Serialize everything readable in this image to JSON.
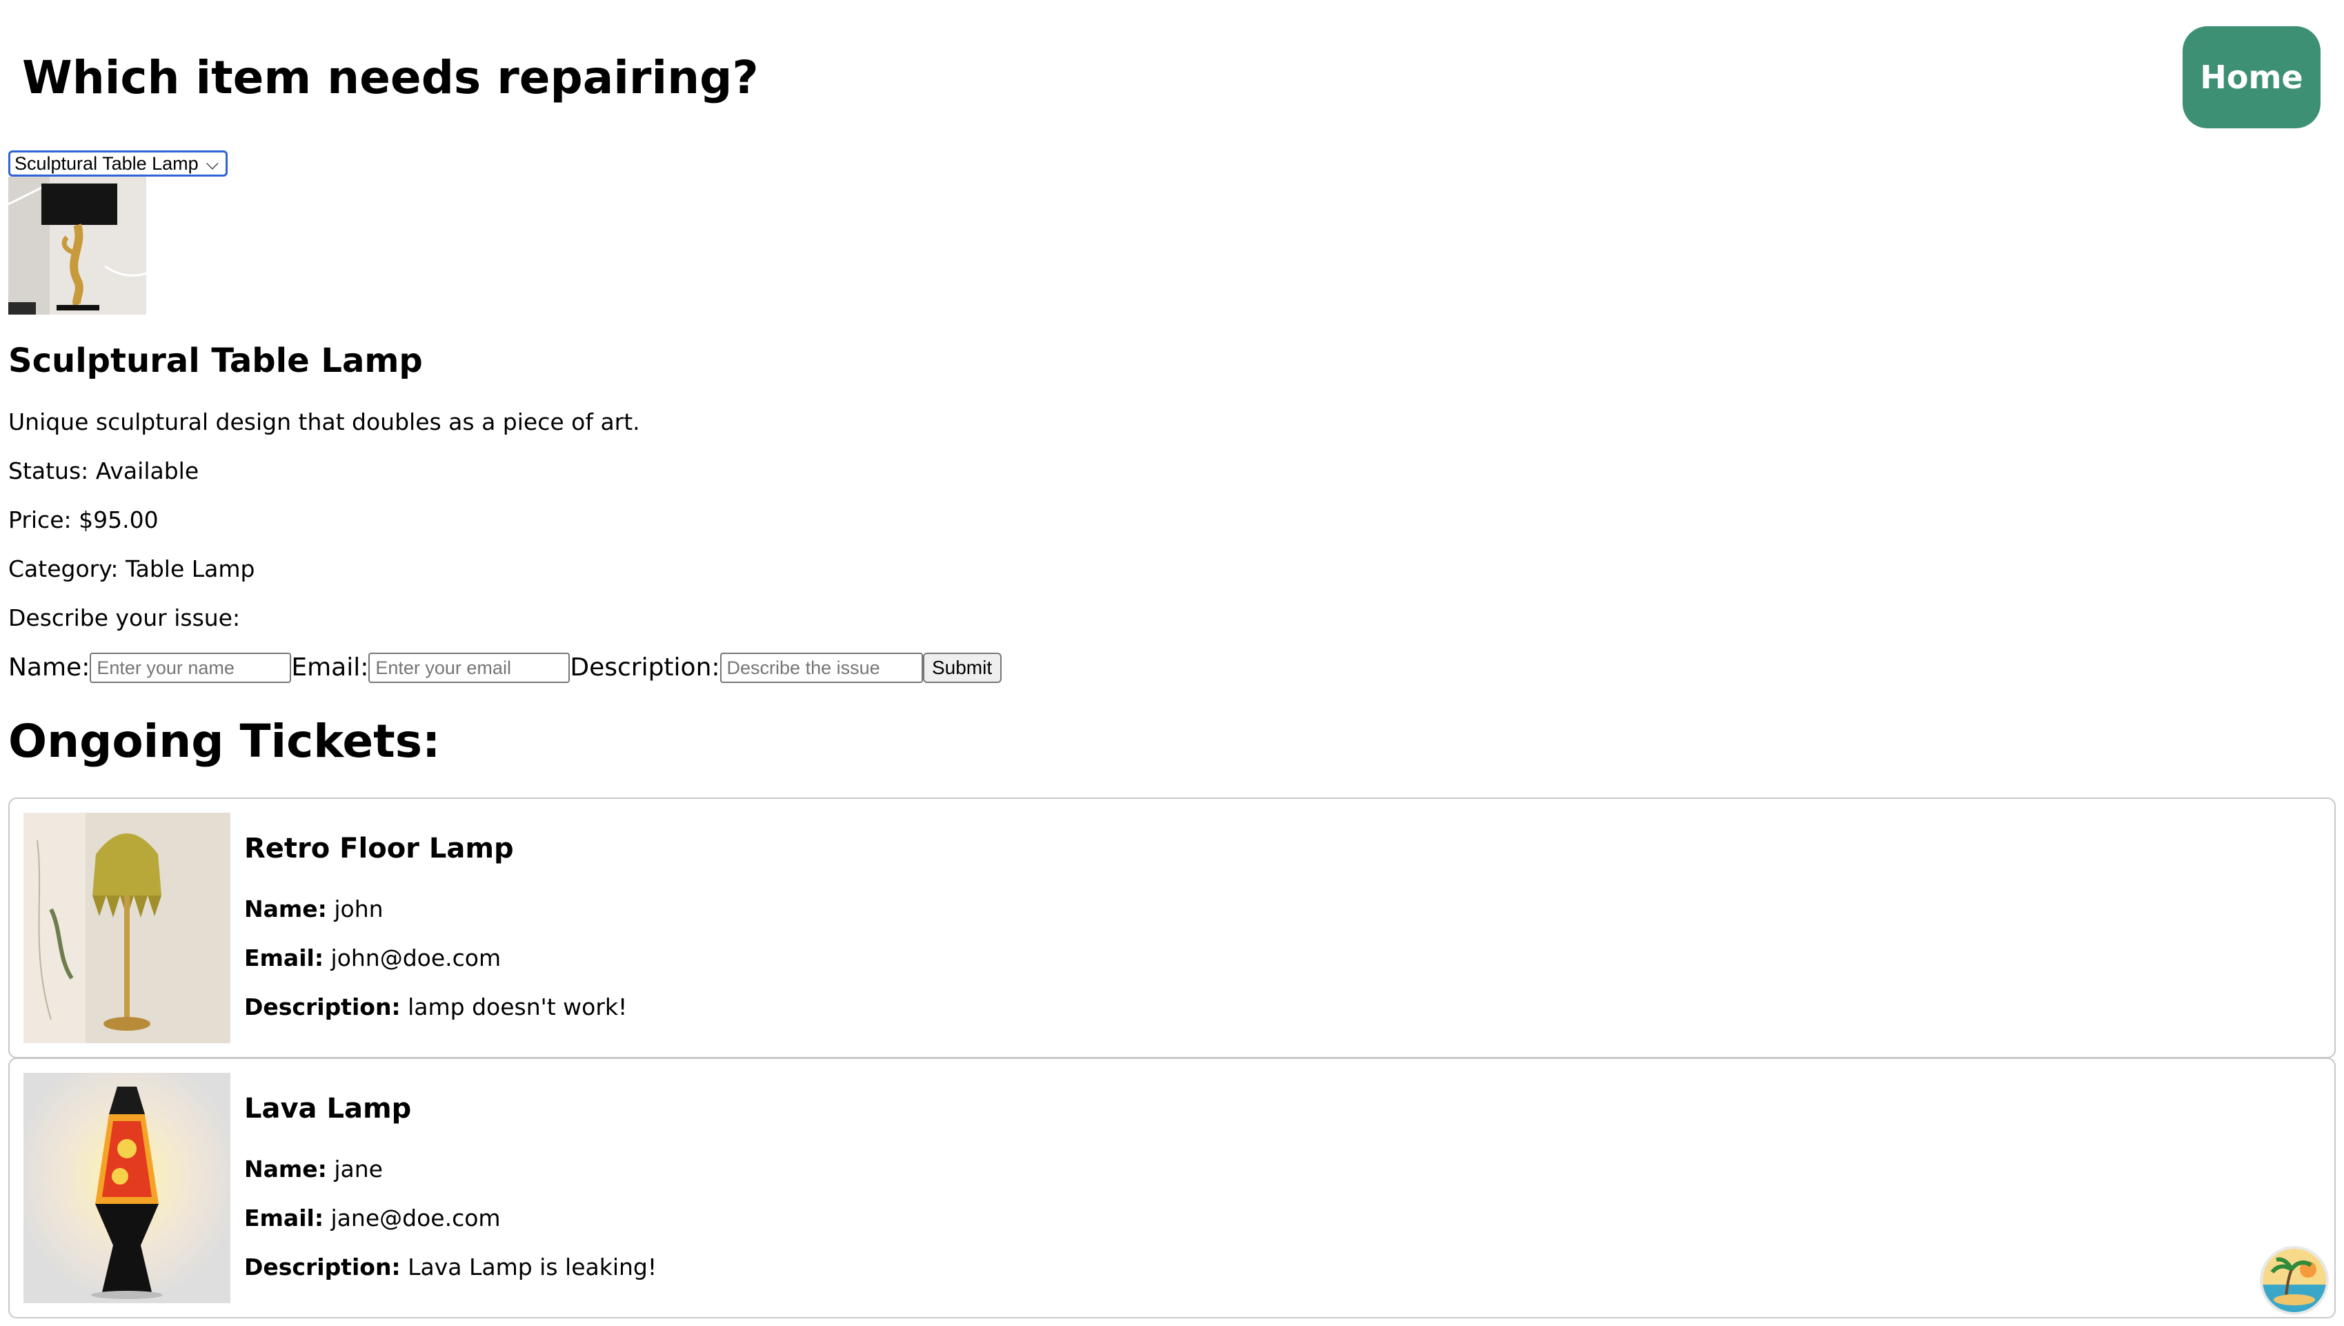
{
  "header": {
    "title": "Which item needs repairing?",
    "home_label": "Home",
    "home_color": "#3d9073"
  },
  "selector": {
    "selected": "Sculptural Table Lamp"
  },
  "item": {
    "name": "Sculptural Table Lamp",
    "description": "Unique sculptural design that doubles as a piece of art.",
    "status": "Status: Available",
    "price": "Price: $95.00",
    "category": "Category: Table Lamp",
    "issue_prompt": "Describe your issue:"
  },
  "form": {
    "name_label": "Name:",
    "name_placeholder": "Enter your name",
    "email_label": "Email:",
    "email_placeholder": "Enter your email",
    "description_label": "Description:",
    "description_placeholder": "Describe the issue",
    "submit_label": "Submit"
  },
  "tickets": {
    "heading": "Ongoing Tickets:",
    "items": [
      {
        "title": "Retro Floor Lamp",
        "name_key": "Name:",
        "name": "john",
        "email_key": "Email:",
        "email": "john@doe.com",
        "description_key": "Description:",
        "description": "lamp doesn't work!"
      },
      {
        "title": "Lava Lamp",
        "name_key": "Name:",
        "name": "jane",
        "email_key": "Email:",
        "email": "jane@doe.com",
        "description_key": "Description:",
        "description": "Lava Lamp is leaking!"
      }
    ]
  },
  "icons": {
    "select_chevron": "chevron-down-icon",
    "avatar": "avatar-palm-beach"
  }
}
